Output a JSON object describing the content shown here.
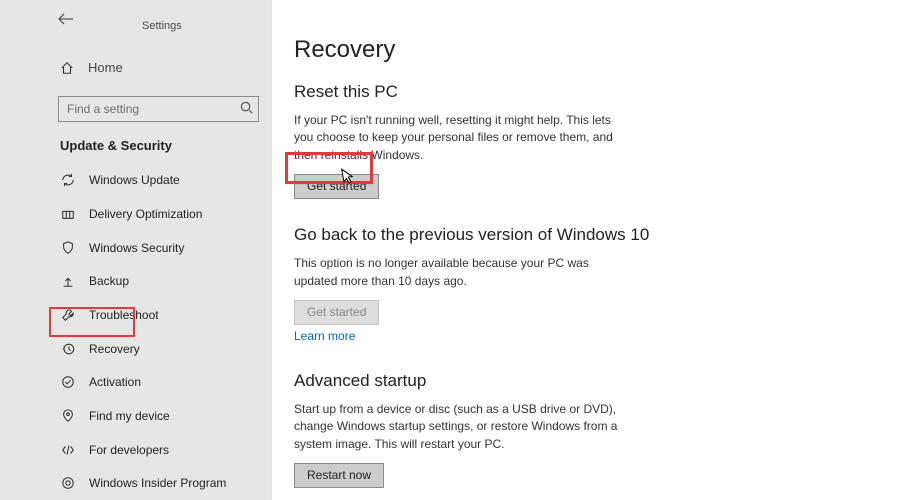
{
  "window": {
    "title": "Settings"
  },
  "sidebar": {
    "home_label": "Home",
    "search_placeholder": "Find a setting",
    "section_title": "Update & Security",
    "items": [
      {
        "icon": "sync-icon",
        "label": "Windows Update"
      },
      {
        "icon": "delivery-icon",
        "label": "Delivery Optimization"
      },
      {
        "icon": "shield-icon",
        "label": "Windows Security"
      },
      {
        "icon": "backup-icon",
        "label": "Backup"
      },
      {
        "icon": "wrench-icon",
        "label": "Troubleshoot"
      },
      {
        "icon": "history-icon",
        "label": "Recovery"
      },
      {
        "icon": "check-icon",
        "label": "Activation"
      },
      {
        "icon": "find-icon",
        "label": "Find my device"
      },
      {
        "icon": "devmode-icon",
        "label": "For developers"
      },
      {
        "icon": "insider-icon",
        "label": "Windows Insider Program"
      }
    ]
  },
  "main": {
    "title": "Recovery",
    "reset": {
      "heading": "Reset this PC",
      "desc": "If your PC isn't running well, resetting it might help. This lets you choose to keep your personal files or remove them, and then reinstalls Windows.",
      "button": "Get started"
    },
    "goback": {
      "heading": "Go back to the previous version of Windows 10",
      "desc": "This option is no longer available because your PC was updated more than 10 days ago.",
      "button": "Get started",
      "learn_more": "Learn more"
    },
    "advanced": {
      "heading": "Advanced startup",
      "desc": "Start up from a device or disc (such as a USB drive or DVD), change Windows startup settings, or restore Windows from a system image. This will restart your PC.",
      "button": "Restart now"
    }
  }
}
